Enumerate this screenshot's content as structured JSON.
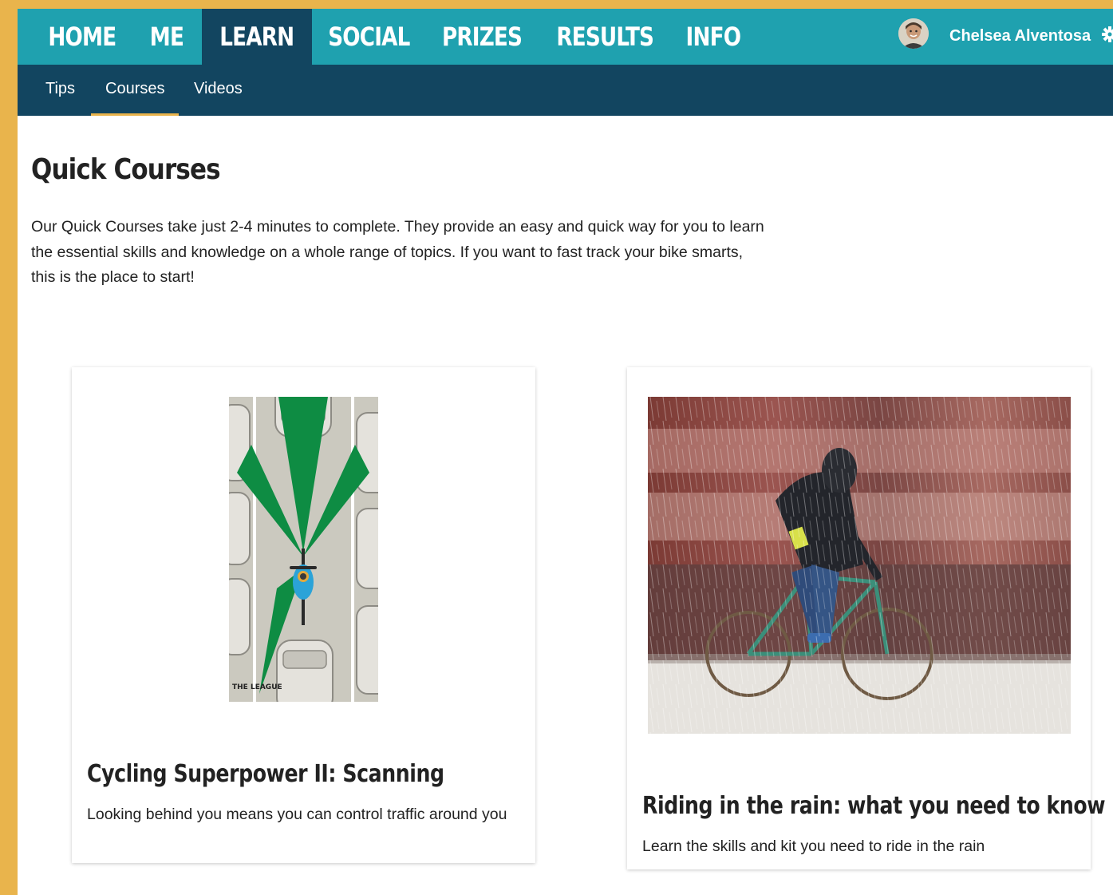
{
  "nav": {
    "tabs": [
      {
        "label": "HOME"
      },
      {
        "label": "ME"
      },
      {
        "label": "LEARN"
      },
      {
        "label": "SOCIAL"
      },
      {
        "label": "PRIZES"
      },
      {
        "label": "RESULTS"
      },
      {
        "label": "INFO"
      }
    ],
    "active_tab": "LEARN",
    "user": {
      "name": "Chelsea Alventosa"
    }
  },
  "subnav": {
    "tabs": [
      {
        "label": "Tips"
      },
      {
        "label": "Courses"
      },
      {
        "label": "Videos"
      }
    ],
    "active_tab": "Courses"
  },
  "main": {
    "title": "Quick Courses",
    "intro": "Our Quick Courses take just 2-4 minutes to complete. They provide an easy and quick way for you to learn the essential skills and knowledge on a whole range of topics. If you want to fast track your bike smarts, this is the place to start!",
    "courses": [
      {
        "title": "Cycling Superpower II: Scanning",
        "description": "Looking behind you means you can control traffic around you",
        "image_text": "THE LEAGUE"
      },
      {
        "title": "Riding in the rain: what you need to know",
        "description": "Learn the skills and kit you need to ride in the rain"
      }
    ]
  },
  "colors": {
    "page_border": "#E9B44C",
    "nav_bg": "#1FA1AF",
    "nav_active_bg": "#124560",
    "subnav_bg": "#124560",
    "subnav_underline": "#E9B44C"
  }
}
